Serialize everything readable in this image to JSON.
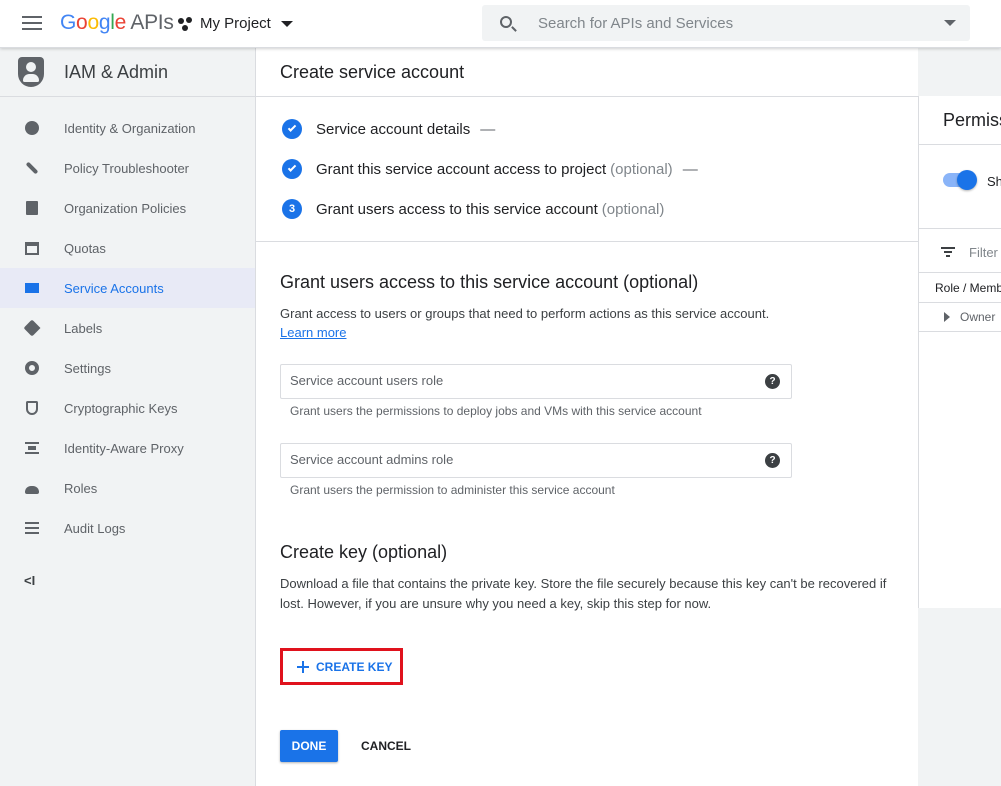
{
  "header": {
    "logo_google": [
      "G",
      "o",
      "o",
      "g",
      "l",
      "e"
    ],
    "logo_apis": "APIs",
    "project": "My Project",
    "search_placeholder": "Search for APIs and Services"
  },
  "sidebar": {
    "title": "IAM & Admin",
    "items": [
      {
        "label": "Identity & Organization",
        "icon": "person-icon"
      },
      {
        "label": "Policy Troubleshooter",
        "icon": "wrench-icon"
      },
      {
        "label": "Organization Policies",
        "icon": "document-icon"
      },
      {
        "label": "Quotas",
        "icon": "calendar-icon"
      },
      {
        "label": "Service Accounts",
        "icon": "service-account-icon",
        "active": true
      },
      {
        "label": "Labels",
        "icon": "tag-icon"
      },
      {
        "label": "Settings",
        "icon": "gear-icon"
      },
      {
        "label": "Cryptographic Keys",
        "icon": "key-shield-icon"
      },
      {
        "label": "Identity-Aware Proxy",
        "icon": "proxy-icon"
      },
      {
        "label": "Roles",
        "icon": "roles-icon"
      },
      {
        "label": "Audit Logs",
        "icon": "list-icon"
      }
    ],
    "collapse_label": "<I"
  },
  "main": {
    "title": "Create service account",
    "steps": [
      {
        "label": "Service account details",
        "optional": "",
        "dash": "—"
      },
      {
        "label": "Grant this service account access to project",
        "optional": "(optional)",
        "dash": "—"
      },
      {
        "label": "Grant users access to this service account",
        "optional": "(optional)",
        "number": "3"
      }
    ],
    "grant": {
      "heading": "Grant users access to this service account (optional)",
      "description": "Grant access to users or groups that need to perform actions as this service account.",
      "learn_more": "Learn more",
      "users_role_placeholder": "Service account users role",
      "users_role_hint": "Grant users the permissions to deploy jobs and VMs with this service account",
      "admins_role_placeholder": "Service account admins role",
      "admins_role_hint": "Grant users the permission to administer this service account"
    },
    "key": {
      "heading": "Create key (optional)",
      "description": "Download a file that contains the private key. Store the file securely because this key can't be recovered if lost. However, if you are unsure why you need a key, skip this step for now.",
      "create_key_label": "CREATE KEY"
    },
    "done_label": "DONE",
    "cancel_label": "CANCEL"
  },
  "right_panel": {
    "title": "Permissions",
    "toggle_label": "Show inherited permissions",
    "filter_placeholder": "Filter",
    "column_header": "Role / Member",
    "row_label": "Owner"
  }
}
